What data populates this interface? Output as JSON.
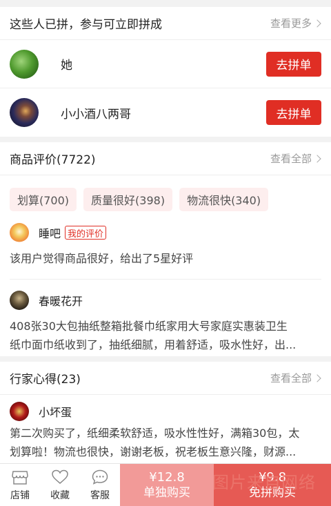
{
  "group_buy": {
    "title": "这些人已拼，参与可立即拼成",
    "more": "查看更多",
    "users": [
      {
        "name": "她",
        "button": "去拼单",
        "avatar": "green-plant-avatar"
      },
      {
        "name": "小小酒八两哥",
        "button": "去拼单",
        "avatar": "night-city-avatar"
      }
    ]
  },
  "reviews": {
    "title": "商品评价(7722)",
    "more": "查看全部",
    "tags": [
      "划算(700)",
      "质量很好(398)",
      "物流很快(340)"
    ],
    "items": [
      {
        "name": "睡吧",
        "badge": "我的评价",
        "text": "该用户觉得商品很好，给出了5星好评"
      },
      {
        "name": "春暖花开",
        "badge": "",
        "text_lines": [
          "408张30大包抽纸整箱批餐巾纸家用大号家庭实惠装卫生",
          "纸巾面巾纸收到了，抽纸细腻，用着舒适，吸水性好，出..."
        ]
      }
    ]
  },
  "experts": {
    "title": "行家心得(23)",
    "more": "查看全部",
    "item": {
      "name": "小坏蛋",
      "text_lines": [
        "第二次购买了，纸细柔软舒适，吸水性性好，满箱30包，太",
        "划算啦！物流也很快，谢谢老板，祝老板生意兴隆，财源..."
      ]
    }
  },
  "bottom_bar": {
    "nav": [
      {
        "label": "店铺",
        "icon": "store-icon"
      },
      {
        "label": "收藏",
        "icon": "heart-icon"
      },
      {
        "label": "客服",
        "icon": "chat-icon"
      }
    ],
    "single": {
      "price": "¥12.8",
      "label": "单独购买"
    },
    "group": {
      "price": "¥9.8",
      "label": "免拼购买"
    },
    "watermark": "图片来自网络"
  },
  "colors": {
    "accent": "#e02e24",
    "single_bg": "#f29a98",
    "group_bg": "#e65a54",
    "tag_bg": "#fdeeee"
  }
}
